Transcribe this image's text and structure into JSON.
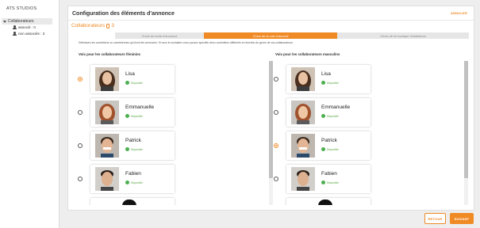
{
  "sidebar": {
    "brand": "ATS STUDIOS",
    "tree": {
      "root_label": "Collaborateurs",
      "children": [
        {
          "label": "associé : 0"
        },
        {
          "label": "non associés : 3"
        }
      ]
    }
  },
  "card": {
    "title": "Configuration des éléments d'annonce",
    "cancel_label": "ANNULER",
    "section_title": "Collaborateurs",
    "section_count": "3",
    "tabs": [
      {
        "label": "Choix du texte d'annonce",
        "active": false
      },
      {
        "label": "Choix de la voix d'accueil",
        "active": true
      },
      {
        "label": "Choix de la musique d'ambiance",
        "active": false
      }
    ],
    "description": "Définissez les comédiens ou comédiennes qui liront les annonces. Si vous le souhaitez vous pouvez spécifier deux comédiens différents en fonction du genre de vos collaborateurs.",
    "female_column": {
      "header": "Voix pour les collaborateurs féminins",
      "selected": "Lisa",
      "voices": [
        {
          "name": "Lisa",
          "status": "Disponible"
        },
        {
          "name": "Emmanuelle",
          "status": "Disponible"
        },
        {
          "name": "Patrick",
          "status": "Disponible"
        },
        {
          "name": "Fabien",
          "status": "Disponible"
        }
      ]
    },
    "male_column": {
      "header": "Voix pour les collaborateurs masculins",
      "selected": "Patrick",
      "voices": [
        {
          "name": "Lisa",
          "status": "Disponible"
        },
        {
          "name": "Emmanuelle",
          "status": "Disponible"
        },
        {
          "name": "Patrick",
          "status": "Disponible"
        },
        {
          "name": "Fabien",
          "status": "Disponible"
        }
      ]
    }
  },
  "footer": {
    "back_label": "RETOUR",
    "next_label": "SUIVANT"
  },
  "colors": {
    "accent": "#f08a24",
    "available": "#4caf50"
  }
}
